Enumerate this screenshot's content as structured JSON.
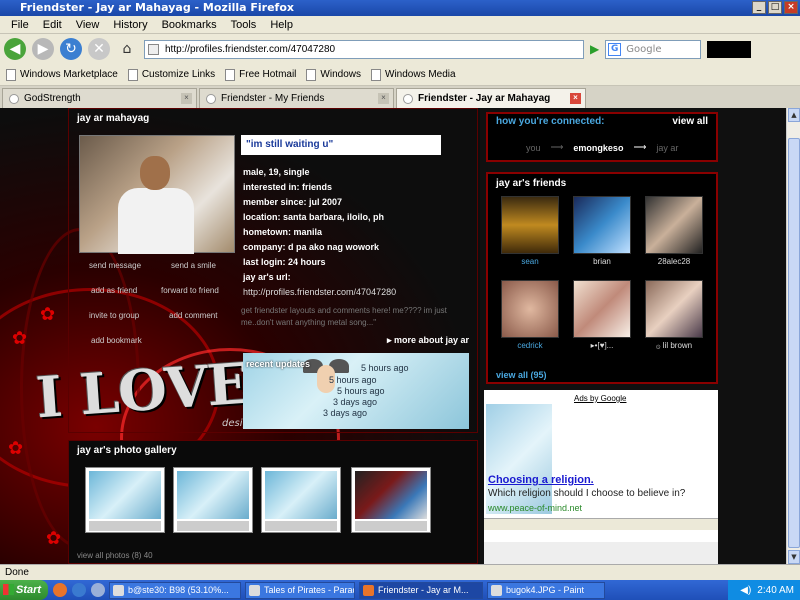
{
  "window": {
    "title": "Friendster - Jay ar Mahayag - Mozilla Firefox"
  },
  "menu": [
    "File",
    "Edit",
    "View",
    "History",
    "Bookmarks",
    "Tools",
    "Help"
  ],
  "nav": {
    "url": "http://profiles.friendster.com/47047280",
    "search_placeholder": "Google"
  },
  "bookmarks": [
    "Windows Marketplace",
    "Customize Links",
    "Free Hotmail",
    "Windows",
    "Windows Media"
  ],
  "tabs": [
    {
      "label": "GodStrength"
    },
    {
      "label": "Friendster - My Friends"
    },
    {
      "label": "Friendster - Jay ar Mahayag"
    }
  ],
  "profile": {
    "name": "jay ar mahayag",
    "quote": "\"im still waiting u\"",
    "info": [
      "male, 19, single",
      "interested in: friends",
      "member since: jul 2007",
      "location: santa barbara, iloilo, ph",
      "hometown: manila",
      "company: d pa ako nag wowork",
      "last login: 24 hours",
      "jay ar's url:"
    ],
    "url": "http://profiles.friendster.com/47047280",
    "about": "get friendster layouts and comments here! me???? im just me..don't want anything metal song...\"",
    "more_about": "▸ more about jay ar",
    "links": [
      "send message",
      "send a smile",
      "add as friend",
      "forward to friend",
      "invite to group",
      "add comment",
      "add bookmark"
    ]
  },
  "updates": {
    "heading": "recent updates",
    "items": [
      "5 hours ago",
      "5 hours ago",
      "5 hours ago",
      "3 days ago",
      "3 days ago"
    ]
  },
  "banner": {
    "text": "I LOVE Y",
    "design": "desig"
  },
  "gallery": {
    "title": "jay ar's photo gallery",
    "view_all": "view all photos (8) 40"
  },
  "connection": {
    "title": "how you're connected:",
    "view_all": "view all",
    "you": "you",
    "via": "emongkeso",
    "target": "jay ar"
  },
  "friends": {
    "title": "jay ar's friends",
    "items": [
      {
        "name": "sean",
        "color": "#4aa8e0"
      },
      {
        "name": "brian",
        "color": "#ddd"
      },
      {
        "name": "28alec28",
        "color": "#ddd"
      },
      {
        "name": "cedrick",
        "color": "#4aa8e0"
      },
      {
        "name": "▸•[♥]...",
        "color": "#ddd"
      },
      {
        "name": "۞ lil brown",
        "color": "#ddd"
      }
    ],
    "view_all": "view all (95)"
  },
  "ads": {
    "header": "Ads by Google",
    "title": "Choosing a religion.",
    "text": "Which religion should I choose to believe in?",
    "url": "www.peace-of-mind.net"
  },
  "status": "Done",
  "taskbar": {
    "start": "Start",
    "items": [
      "b@ste30: B98 (53.10%...",
      "Tales of Pirates - Paradis...",
      "Friendster - Jay ar M...",
      "bugok4.JPG - Paint"
    ],
    "clock": "2:40 AM"
  }
}
